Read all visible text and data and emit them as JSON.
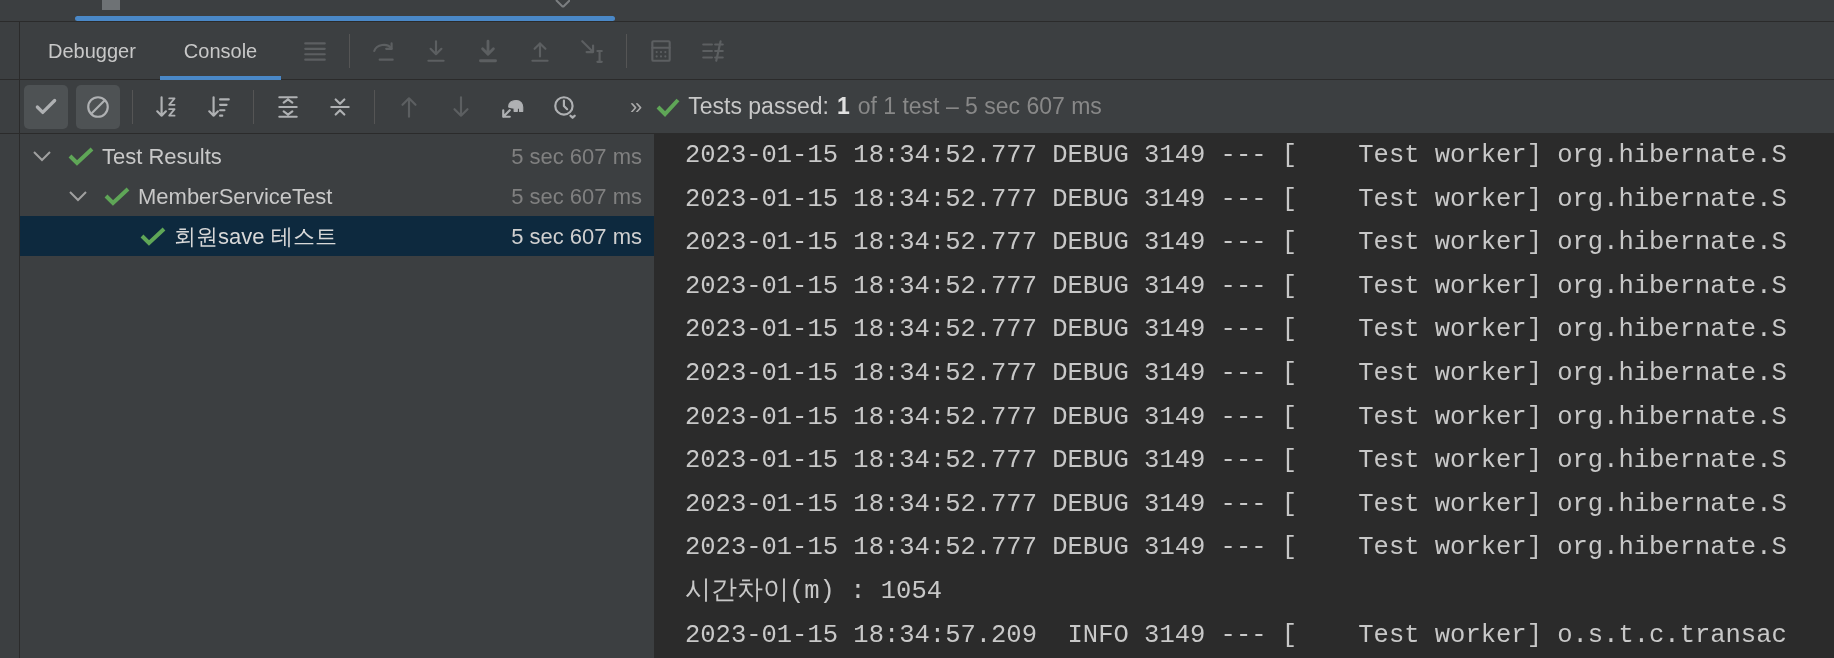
{
  "tabs": [
    {
      "label": "Debugger",
      "selected": false
    },
    {
      "label": "Console",
      "selected": true
    }
  ],
  "debug_toolbar": [
    {
      "kind": "menu",
      "disabled": true
    },
    {
      "kind": "divider"
    },
    {
      "kind": "step-over",
      "disabled": true
    },
    {
      "kind": "step-into",
      "disabled": true
    },
    {
      "kind": "force-step-into",
      "disabled": true
    },
    {
      "kind": "step-out",
      "disabled": true
    },
    {
      "kind": "run-to-cursor",
      "disabled": true
    },
    {
      "kind": "divider"
    },
    {
      "kind": "calculator",
      "disabled": true
    },
    {
      "kind": "trace",
      "disabled": true
    }
  ],
  "test_toolbar": [
    {
      "kind": "check",
      "selected": true,
      "disabled": false
    },
    {
      "kind": "cancel",
      "selected": true,
      "disabled": false
    },
    {
      "kind": "divider"
    },
    {
      "kind": "sort-alpha",
      "selected": false,
      "disabled": false
    },
    {
      "kind": "sort-duration",
      "selected": false,
      "disabled": false
    },
    {
      "kind": "divider"
    },
    {
      "kind": "expand",
      "selected": false,
      "disabled": false
    },
    {
      "kind": "collapse",
      "selected": false,
      "disabled": false
    },
    {
      "kind": "divider"
    },
    {
      "kind": "up",
      "selected": false,
      "disabled": true
    },
    {
      "kind": "down",
      "selected": false,
      "disabled": true
    },
    {
      "kind": "elephant",
      "selected": false,
      "disabled": false
    },
    {
      "kind": "clock",
      "selected": false,
      "disabled": false
    }
  ],
  "more_glyph": "»",
  "status": {
    "passed": true,
    "label": "Tests passed:",
    "count": "1",
    "summary": "of 1 test – 5 sec 607 ms"
  },
  "tree": [
    {
      "label": "Test Results",
      "duration": "5 sec 607 ms",
      "passed": true,
      "expanded": true,
      "selected": false,
      "children": [
        {
          "label": "MemberServiceTest",
          "duration": "5 sec 607 ms",
          "passed": true,
          "expanded": true,
          "selected": false,
          "children": [
            {
              "label": "회원save 테스트",
              "duration": "5 sec 607 ms",
              "passed": true,
              "selected": true
            }
          ]
        }
      ]
    }
  ],
  "console_lines": [
    "2023-01-15 18:34:52.777 DEBUG 3149 --- [    Test worker] org.hibernate.S",
    "2023-01-15 18:34:52.777 DEBUG 3149 --- [    Test worker] org.hibernate.S",
    "2023-01-15 18:34:52.777 DEBUG 3149 --- [    Test worker] org.hibernate.S",
    "2023-01-15 18:34:52.777 DEBUG 3149 --- [    Test worker] org.hibernate.S",
    "2023-01-15 18:34:52.777 DEBUG 3149 --- [    Test worker] org.hibernate.S",
    "2023-01-15 18:34:52.777 DEBUG 3149 --- [    Test worker] org.hibernate.S",
    "2023-01-15 18:34:52.777 DEBUG 3149 --- [    Test worker] org.hibernate.S",
    "2023-01-15 18:34:52.777 DEBUG 3149 --- [    Test worker] org.hibernate.S",
    "2023-01-15 18:34:52.777 DEBUG 3149 --- [    Test worker] org.hibernate.S",
    "2023-01-15 18:34:52.777 DEBUG 3149 --- [    Test worker] org.hibernate.S",
    "시간차이(m) : 1054",
    "2023-01-15 18:34:57.209  INFO 3149 --- [    Test worker] o.s.t.c.transac"
  ]
}
